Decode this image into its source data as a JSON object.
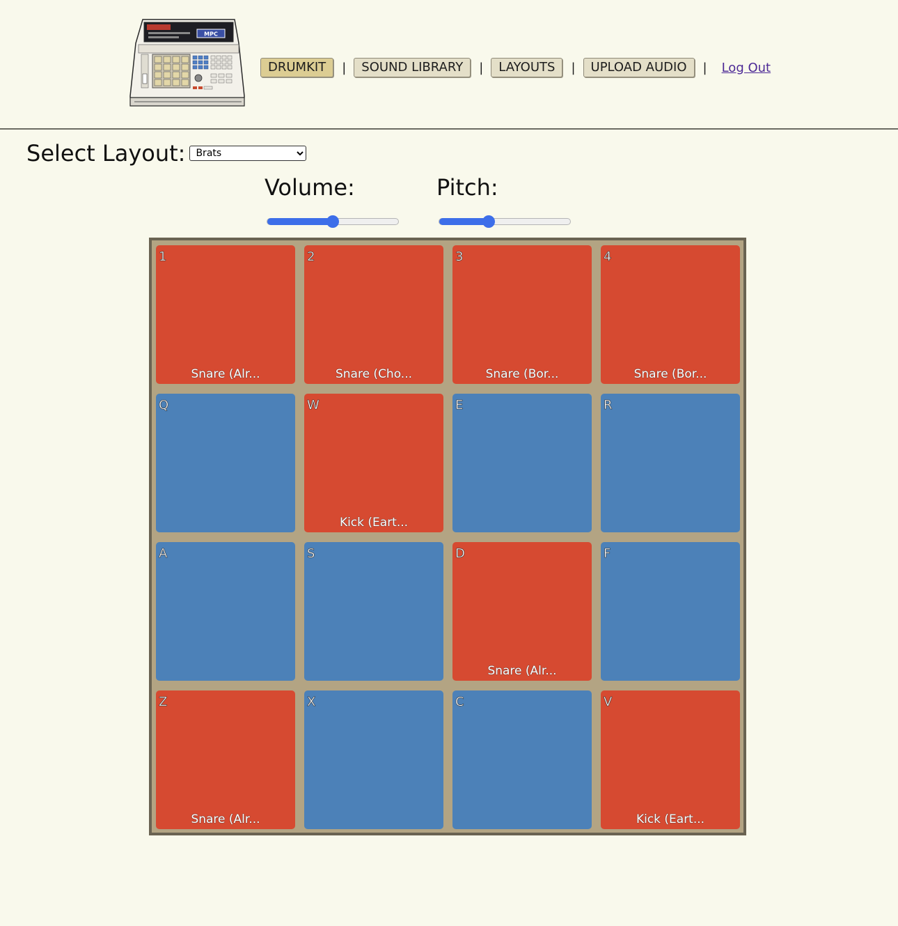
{
  "nav": {
    "drumkit": "DRUMKIT",
    "sound_library": "SOUND LIBRARY",
    "layouts": "LAYOUTS",
    "upload_audio": "UPLOAD AUDIO",
    "separator": "|",
    "logout": "Log Out",
    "active": "DRUMKIT"
  },
  "logo": {
    "icon": "mpc-sampler-icon",
    "brand_text": "MPC"
  },
  "layout_selector": {
    "label": "Select Layout:",
    "selected": "Brats"
  },
  "controls": {
    "volume_label": "Volume:",
    "volume_level": 0.5,
    "pitch_label": "Pitch:",
    "pitch_level": 0.38
  },
  "colors": {
    "background": "#f9f9ec",
    "assigned_pad": "#d64a31",
    "empty_pad": "#4c81b8",
    "board": "#b3a483",
    "slider": "#3d6ee9"
  },
  "pads": [
    {
      "key": "1",
      "sound": "Snare (Alr...",
      "assigned": true
    },
    {
      "key": "2",
      "sound": "Snare (Cho...",
      "assigned": true
    },
    {
      "key": "3",
      "sound": "Snare (Bor...",
      "assigned": true
    },
    {
      "key": "4",
      "sound": "Snare (Bor...",
      "assigned": true
    },
    {
      "key": "Q",
      "sound": "",
      "assigned": false
    },
    {
      "key": "W",
      "sound": "Kick (Eart...",
      "assigned": true
    },
    {
      "key": "E",
      "sound": "",
      "assigned": false
    },
    {
      "key": "R",
      "sound": "",
      "assigned": false
    },
    {
      "key": "A",
      "sound": "",
      "assigned": false
    },
    {
      "key": "S",
      "sound": "",
      "assigned": false
    },
    {
      "key": "D",
      "sound": "Snare (Alr...",
      "assigned": true
    },
    {
      "key": "F",
      "sound": "",
      "assigned": false
    },
    {
      "key": "Z",
      "sound": "Snare (Alr...",
      "assigned": true
    },
    {
      "key": "X",
      "sound": "",
      "assigned": false
    },
    {
      "key": "C",
      "sound": "",
      "assigned": false
    },
    {
      "key": "V",
      "sound": "Kick (Eart...",
      "assigned": true
    }
  ]
}
